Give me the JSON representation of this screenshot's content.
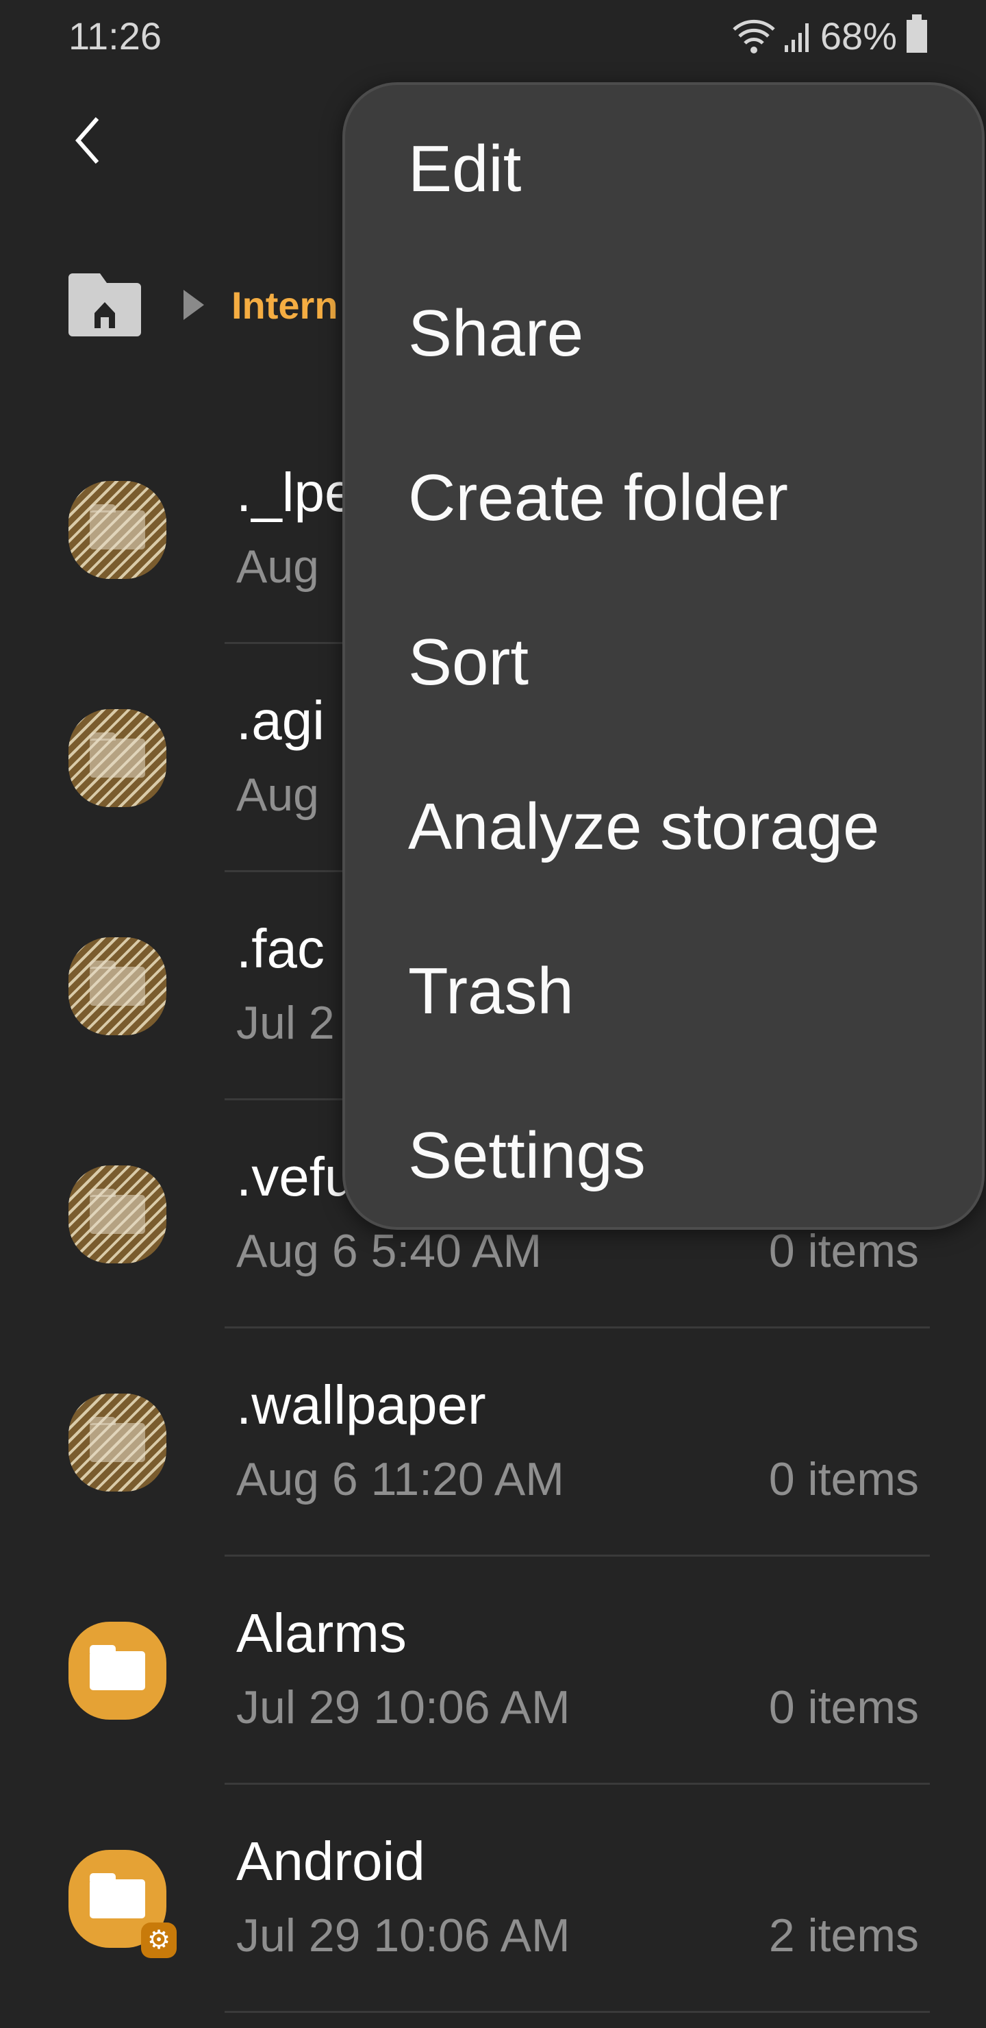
{
  "status_bar": {
    "time": "11:26",
    "battery": "68%",
    "icons": [
      "wifi-icon",
      "signal-icon",
      "battery-icon"
    ]
  },
  "header": {
    "back_icon": "chevron-left-icon"
  },
  "breadcrumb": {
    "home_icon": "home-folder-icon",
    "current": "Intern"
  },
  "colors": {
    "accent": "#f5ad42",
    "folder": "#e5a235",
    "background": "#242424",
    "menu": "#3d3d3d"
  },
  "files": [
    {
      "name": "._lpe",
      "date": "Aug",
      "count": "",
      "hidden": true
    },
    {
      "name": ".agi",
      "date": "Aug",
      "count": "",
      "hidden": true
    },
    {
      "name": ".fac",
      "date": "Jul 2",
      "count": "",
      "hidden": true
    },
    {
      "name": ".vefu",
      "date": "Aug 6 5:40 AM",
      "count": "0 items",
      "hidden": true
    },
    {
      "name": ".wallpaper",
      "date": "Aug 6 11:20 AM",
      "count": "0 items",
      "hidden": true
    },
    {
      "name": "Alarms",
      "date": "Jul 29 10:06 AM",
      "count": "0 items",
      "hidden": false
    },
    {
      "name": "Android",
      "date": "Jul 29 10:06 AM",
      "count": "2 items",
      "hidden": false,
      "badge": "gear-icon"
    }
  ],
  "menu": {
    "items": [
      "Edit",
      "Share",
      "Create folder",
      "Sort",
      "Analyze storage",
      "Trash",
      "Settings"
    ]
  }
}
